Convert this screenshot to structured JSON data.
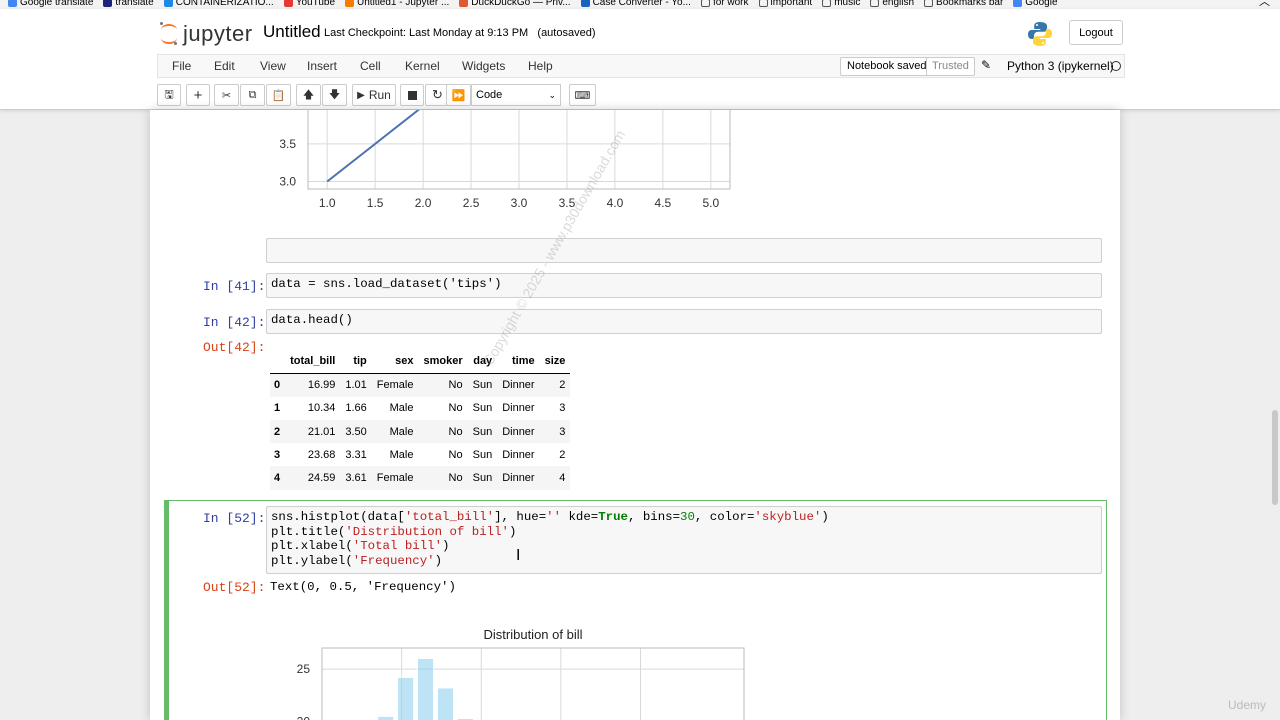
{
  "bookmarks": [
    {
      "label": "Google translate",
      "color": "#4285f4"
    },
    {
      "label": "translate",
      "color": "#1a237e"
    },
    {
      "label": "CONTAINERIZATIO...",
      "color": "#1e88e5"
    },
    {
      "label": "YouTube",
      "color": "#e53935"
    },
    {
      "label": "Untitled1 - Jupyter ...",
      "color": "#f57c00"
    },
    {
      "label": "DuckDuckGo — Priv...",
      "color": "#de5833"
    },
    {
      "label": "Case Converter - Yo...",
      "color": "#1565c0"
    },
    {
      "label": "for work",
      "color": "folder"
    },
    {
      "label": "important",
      "color": "folder"
    },
    {
      "label": "music",
      "color": "folder"
    },
    {
      "label": "english",
      "color": "folder"
    },
    {
      "label": "Bookmarks bar",
      "color": "folder"
    },
    {
      "label": "Google",
      "color": "#4285f4"
    }
  ],
  "header": {
    "logo_text": "jupyter",
    "notebook_name": "Untitled",
    "checkpoint": "Last Checkpoint: Last Monday at 9:13 PM",
    "autosave": "(autosaved)",
    "logout": "Logout"
  },
  "menubar": {
    "items": [
      "File",
      "Edit",
      "View",
      "Insert",
      "Cell",
      "Kernel",
      "Widgets",
      "Help"
    ],
    "notebook_saved": "Notebook saved",
    "trusted": "Trusted",
    "kernel_name": "Python 3 (ipykernel)"
  },
  "toolbar": {
    "run_label": "Run",
    "cell_type": "Code"
  },
  "cells": {
    "c41": {
      "prompt": "In [41]:",
      "code": "data = sns.load_dataset('tips')"
    },
    "c42": {
      "prompt": "In [42]:",
      "code": "data.head()",
      "out_prompt": "Out[42]:"
    },
    "c52": {
      "prompt": "In [52]:",
      "out_prompt": "Out[52]:",
      "output": "Text(0, 0.5, 'Frequency')"
    }
  },
  "dataframe": {
    "columns": [
      "",
      "total_bill",
      "tip",
      "sex",
      "smoker",
      "day",
      "time",
      "size"
    ],
    "rows": [
      [
        "0",
        "16.99",
        "1.01",
        "Female",
        "No",
        "Sun",
        "Dinner",
        "2"
      ],
      [
        "1",
        "10.34",
        "1.66",
        "Male",
        "No",
        "Sun",
        "Dinner",
        "3"
      ],
      [
        "2",
        "21.01",
        "3.50",
        "Male",
        "No",
        "Sun",
        "Dinner",
        "3"
      ],
      [
        "3",
        "23.68",
        "3.31",
        "Male",
        "No",
        "Sun",
        "Dinner",
        "2"
      ],
      [
        "4",
        "24.59",
        "3.61",
        "Female",
        "No",
        "Sun",
        "Dinner",
        "4"
      ]
    ]
  },
  "chart_data": [
    {
      "type": "line",
      "x": [
        1.0,
        2.0
      ],
      "y": [
        3.0,
        4.0
      ],
      "xticks": [
        "1.0",
        "1.5",
        "2.0",
        "2.5",
        "3.0",
        "3.5",
        "4.0",
        "4.5",
        "5.0"
      ],
      "yticks": [
        "3.0",
        "3.5"
      ],
      "xlim": [
        0.8,
        5.2
      ],
      "ylim": [
        2.9,
        3.95
      ],
      "grid": true,
      "color": "#4c72b0"
    },
    {
      "type": "bar",
      "title": "Distribution of bill",
      "x": [
        8.0,
        10.5,
        13.0,
        15.5,
        18.0
      ],
      "values": [
        20.5,
        24.2,
        26.0,
        23.2,
        20.3
      ],
      "yticks": [
        "25",
        "20"
      ],
      "xlim": [
        0,
        53
      ],
      "ylim": [
        19.5,
        27.0
      ],
      "grid": true,
      "color": "#87ceeb"
    }
  ],
  "watermark": "Copyright © 2025 - www.p30download.com",
  "brand": "Udemy",
  "colors": {
    "accent_green": "#66bb6a",
    "in_prompt": "#303f9f",
    "out_prompt": "#d84315"
  }
}
